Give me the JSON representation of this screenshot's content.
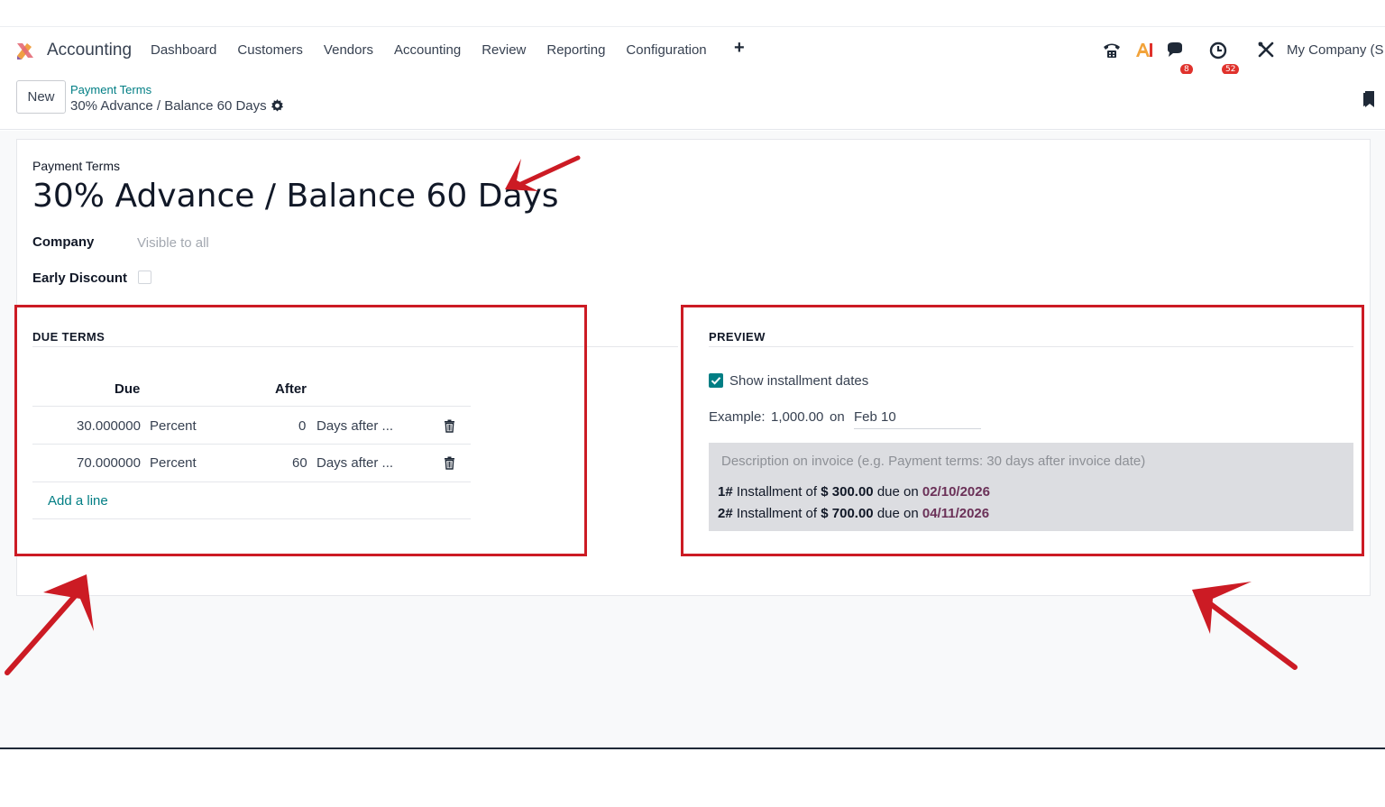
{
  "navbar": {
    "app_name": "Accounting",
    "menu": [
      "Dashboard",
      "Customers",
      "Vendors",
      "Accounting",
      "Review",
      "Reporting",
      "Configuration"
    ],
    "plus": "+",
    "badges": {
      "messages": "8",
      "activities": "52"
    },
    "company": "My Company (S"
  },
  "control": {
    "new_label": "New",
    "breadcrumb_parent": "Payment Terms",
    "breadcrumb_current": "30% Advance / Balance 60 Days"
  },
  "form": {
    "section_label": "Payment Terms",
    "title": "30% Advance / Balance 60 Days",
    "company_label": "Company",
    "company_value": "Visible to all",
    "early_discount_label": "Early Discount",
    "early_discount_checked": false
  },
  "due_terms": {
    "heading": "DUE TERMS",
    "columns": [
      "Due",
      "After"
    ],
    "rows": [
      {
        "value": "30.000000",
        "type": "Percent",
        "days": "0",
        "after": "Days after ..."
      },
      {
        "value": "70.000000",
        "type": "Percent",
        "days": "60",
        "after": "Days after ..."
      }
    ],
    "add_line": "Add a line"
  },
  "preview": {
    "heading": "PREVIEW",
    "show_dates_label": "Show installment dates",
    "show_dates_checked": true,
    "example_label": "Example:",
    "example_amount": "1,000.00",
    "on_label": "on",
    "example_date": "Feb 10",
    "description_placeholder": "Description on invoice (e.g. Payment terms: 30 days after invoice date)",
    "installments": [
      {
        "num": "1#",
        "text1": "Installment of",
        "amount": "$ 300.00",
        "text2": "due on",
        "date": "02/10/2026"
      },
      {
        "num": "2#",
        "text1": "Installment of",
        "amount": "$ 700.00",
        "text2": "due on",
        "date": "04/11/2026"
      }
    ]
  },
  "colors": {
    "accent": "#017e84",
    "annotation": "#cc1b24",
    "date": "#6b3158"
  }
}
